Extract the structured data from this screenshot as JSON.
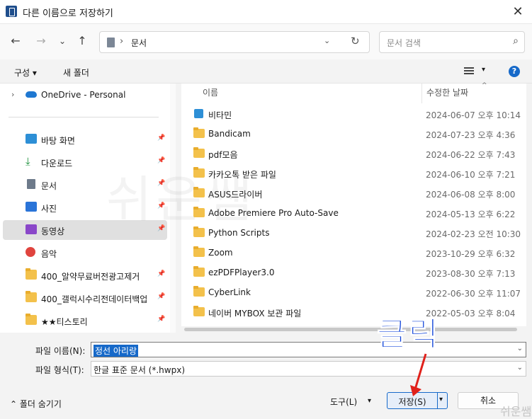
{
  "window": {
    "title": "다른 이름으로 저장하기",
    "close_glyph": "✕"
  },
  "nav": {
    "back": "←",
    "forward": "→",
    "recent": "⌄",
    "up": "↑",
    "address_chevron": "›",
    "address_path": "문서",
    "address_dropdown": "⌄",
    "refresh": "↻",
    "search_placeholder": "문서 검색",
    "search_icon": "⌕"
  },
  "toolbar": {
    "organize": "구성 ▾",
    "new_folder": "새 폴더",
    "view_dropdown": "▾",
    "help": "?"
  },
  "sidebar": {
    "expander": "›",
    "onedrive": "OneDrive - Personal",
    "pin_glyph": "📌",
    "items": [
      {
        "label": "바탕 화면",
        "icon": "desktop-icon"
      },
      {
        "label": "다운로드",
        "icon": "download-icon",
        "glyph": "⤓"
      },
      {
        "label": "문서",
        "icon": "document-icon"
      },
      {
        "label": "사진",
        "icon": "photo-icon"
      },
      {
        "label": "동영상",
        "icon": "video-icon"
      },
      {
        "label": "음악",
        "icon": "music-icon"
      },
      {
        "label": "400_알약무료버전광고제거",
        "icon": "folder-icon"
      },
      {
        "label": "400_갤럭시수리전데이터백업",
        "icon": "folder-icon"
      },
      {
        "label": "★★티스토리",
        "icon": "folder-icon"
      }
    ]
  },
  "filelist": {
    "col_name": "이름",
    "col_date": "수정한 날짜",
    "sort_caret": "^",
    "rows": [
      {
        "name": "비타민",
        "date": "2024-06-07 오후 10:14",
        "icon": "archive-icon"
      },
      {
        "name": "Bandicam",
        "date": "2024-07-23 오후 4:36",
        "icon": "folder-icon"
      },
      {
        "name": "pdf모음",
        "date": "2024-06-22 오후 7:43",
        "icon": "folder-icon"
      },
      {
        "name": "카카오톡 받은 파일",
        "date": "2024-06-10 오후 7:21",
        "icon": "folder-icon"
      },
      {
        "name": "ASUS드라이버",
        "date": "2024-06-08 오후 8:00",
        "icon": "folder-icon"
      },
      {
        "name": "Adobe Premiere Pro Auto-Save",
        "date": "2024-05-13 오후 6:22",
        "icon": "folder-icon"
      },
      {
        "name": "Python Scripts",
        "date": "2024-02-23 오전 10:30",
        "icon": "folder-icon"
      },
      {
        "name": "Zoom",
        "date": "2023-10-29 오후 6:32",
        "icon": "folder-icon"
      },
      {
        "name": "ezPDFPlayer3.0",
        "date": "2023-08-30 오후 7:13",
        "icon": "folder-icon"
      },
      {
        "name": "CyberLink",
        "date": "2022-06-30 오후 11:07",
        "icon": "folder-icon"
      },
      {
        "name": "네이버 MYBOX 보관 파일",
        "date": "2022-05-03 오후 8:04",
        "icon": "folder-icon"
      }
    ]
  },
  "fields": {
    "filename_label": "파일 이름(N):",
    "filename_value": "정선 아리랑",
    "filetype_label": "파일 형식(T):",
    "filetype_value": "한글 표준 문서 (*.hwpx)",
    "dropdown_glyph": "⌄"
  },
  "footer": {
    "hide_folders": "⌃ 폴더 숨기기",
    "tools": "도구(L)",
    "tools_dropdown": "▾",
    "save": "저장(S)",
    "save_dropdown": "▾",
    "cancel": "취소"
  },
  "overlay": {
    "annotation": "클릭",
    "watermark": "쉬운쌤",
    "corner_mark": "쉬운쌤",
    "annotation_color": "#0a3fd8",
    "arrow_color": "#e0211b"
  }
}
